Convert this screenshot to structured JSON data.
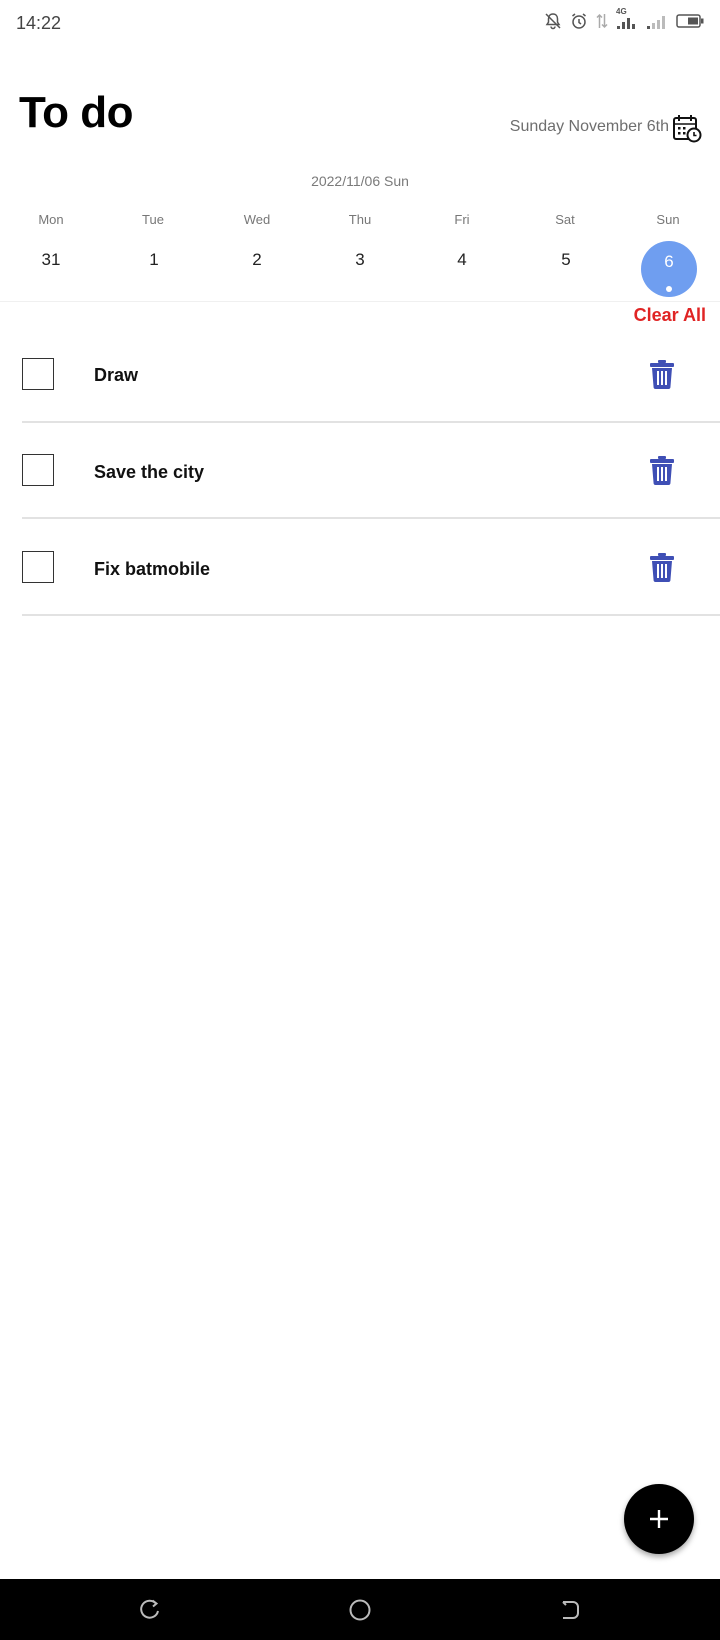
{
  "status_bar": {
    "time": "14:22",
    "network_label": "4G",
    "icons": [
      "bell-off-icon",
      "alarm-icon",
      "data-arrows-icon",
      "signal-icon",
      "signal-icon",
      "battery-icon"
    ]
  },
  "header": {
    "title": "To do",
    "date_text": "Sunday November 6th",
    "calendar_icon": "calendar-clock-icon"
  },
  "week": {
    "label": "2022/11/06 Sun",
    "days": [
      {
        "name": "Mon",
        "num": "31"
      },
      {
        "name": "Tue",
        "num": "1"
      },
      {
        "name": "Wed",
        "num": "2"
      },
      {
        "name": "Thu",
        "num": "3"
      },
      {
        "name": "Fri",
        "num": "4"
      },
      {
        "name": "Sat",
        "num": "5"
      },
      {
        "name": "Sun",
        "num": "6"
      }
    ],
    "selected_index": 6,
    "selected_color": "#6f9ef0"
  },
  "actions": {
    "clear_all": "Clear All",
    "clear_all_color": "#e02424"
  },
  "tasks": [
    {
      "label": "Draw",
      "checked": false
    },
    {
      "label": "Save the city",
      "checked": false
    },
    {
      "label": "Fix batmobile",
      "checked": false
    }
  ],
  "colors": {
    "delete_icon": "#3f4fb5",
    "fab": "#000000"
  },
  "fab": {
    "icon": "plus-icon"
  },
  "nav_bar": {
    "icons": [
      "recents-icon",
      "home-icon",
      "back-icon"
    ]
  }
}
